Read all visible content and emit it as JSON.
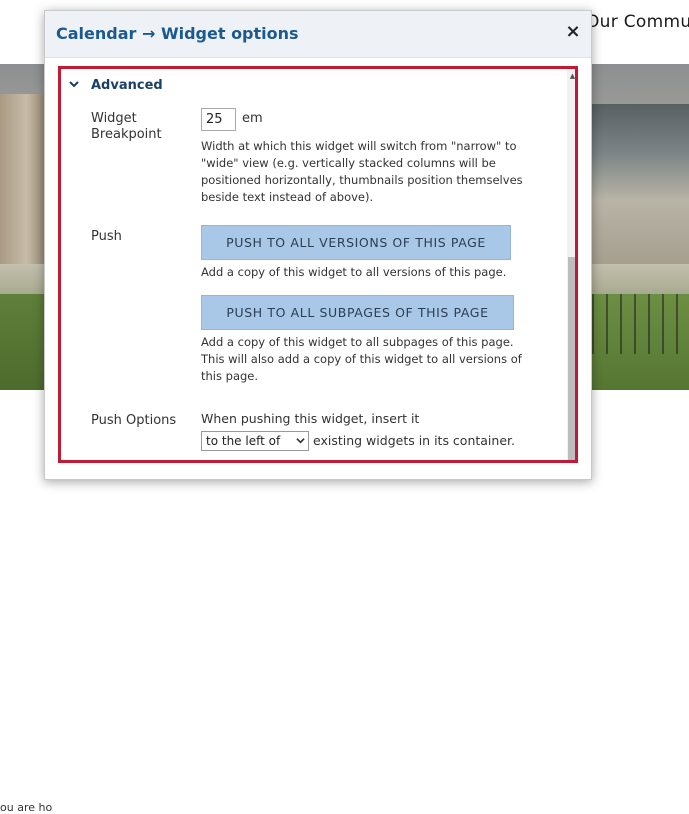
{
  "background": {
    "heading_fragment": "Our Commu",
    "snippet_fragment": "ou are ho"
  },
  "dialog": {
    "title": "Calendar → Widget options",
    "close_icon_glyph": "×"
  },
  "advanced": {
    "section_title": "Advanced",
    "breakpoint": {
      "label_line1": "Widget",
      "label_line2": "Breakpoint",
      "value": "25",
      "unit": "em",
      "help_lines": [
        "Width at which this widget will switch from \"narrow\" to",
        "\"wide\" view (e.g. vertically stacked columns will be",
        "positioned horizontally, thumbnails position themselves",
        "beside text instead of above)."
      ]
    },
    "push": {
      "label": "Push",
      "versions_button": "PUSH TO ALL VERSIONS OF THIS PAGE",
      "versions_help": "Add a copy of this widget to all versions of this page.",
      "subpages_button": "PUSH TO ALL SUBPAGES OF THIS PAGE",
      "subpages_help_lines": [
        "Add a copy of this widget to all subpages of this page.",
        "This will also add a copy of this widget to all versions of",
        "this page."
      ]
    },
    "push_options": {
      "label": "Push Options",
      "intro": "When pushing this widget, insert it",
      "selected_option": "to the left of",
      "suffix": "existing widgets in its container."
    }
  },
  "colors": {
    "title": "#1c5a8e",
    "highlight_border": "#c11a34",
    "button_bg": "#a9c7e6"
  }
}
